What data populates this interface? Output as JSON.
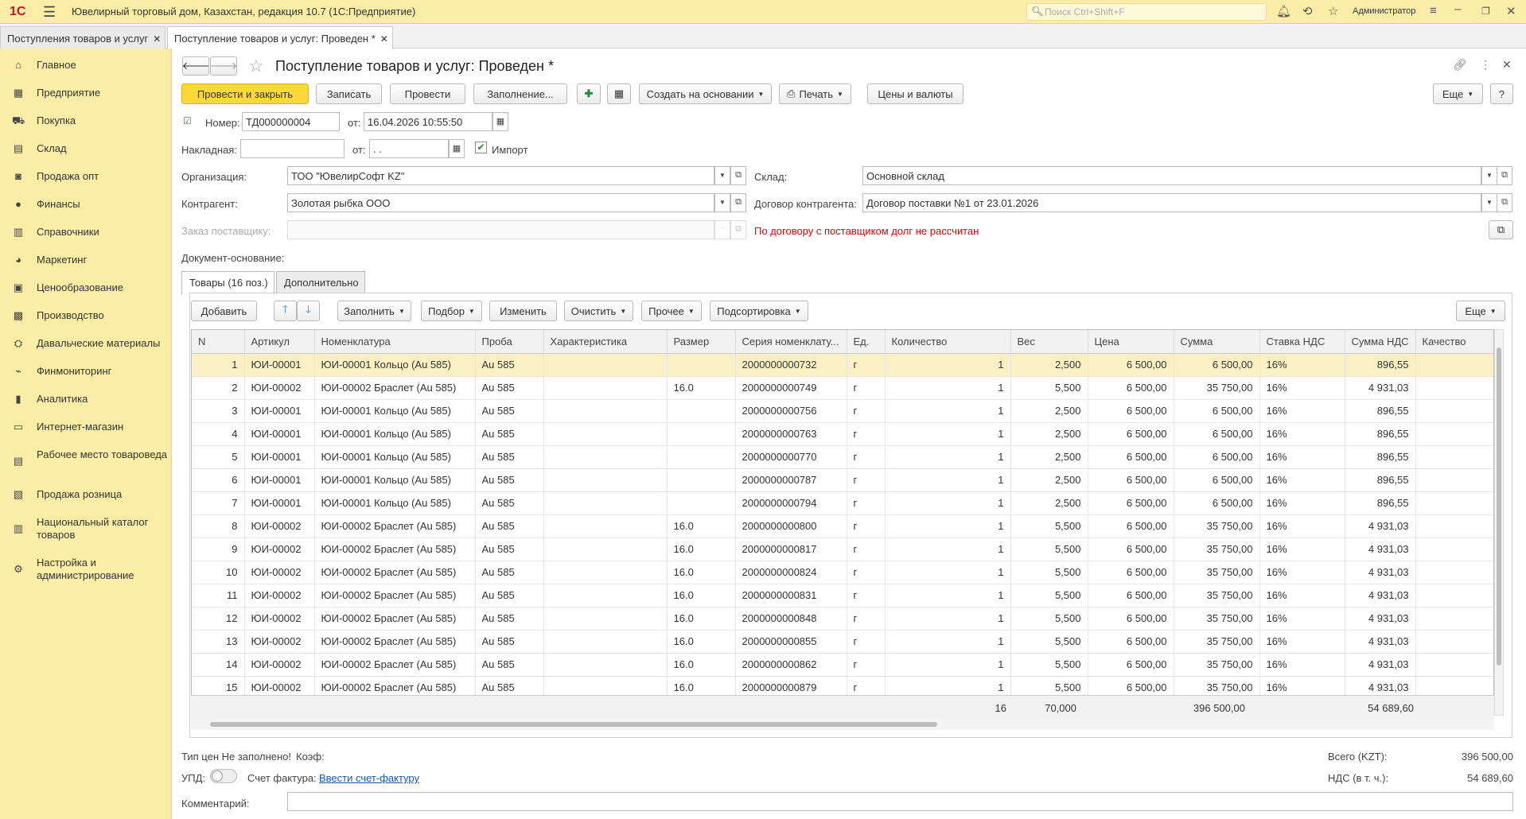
{
  "topbar": {
    "logo": "1С",
    "app_title": "Ювелирный торговый дом, Казахстан, редакция 10.7  (1С:Предприятие)",
    "search_placeholder": "Поиск Ctrl+Shift+F",
    "user": "Администратор"
  },
  "open_tabs": [
    {
      "label": "Поступления товаров и услуг"
    },
    {
      "label": "Поступление товаров и услуг: Проведен *"
    }
  ],
  "sidebar": {
    "items": [
      {
        "label": "Главное",
        "icon": "home-icon"
      },
      {
        "label": "Предприятие",
        "icon": "building-icon"
      },
      {
        "label": "Покупка",
        "icon": "cart-icon"
      },
      {
        "label": "Склад",
        "icon": "warehouse-icon"
      },
      {
        "label": "Продажа опт",
        "icon": "bag-icon"
      },
      {
        "label": "Финансы",
        "icon": "coin-icon"
      },
      {
        "label": "Справочники",
        "icon": "book-icon"
      },
      {
        "label": "Маркетинг",
        "icon": "pie-icon"
      },
      {
        "label": "Ценообразование",
        "icon": "price-icon"
      },
      {
        "label": "Производство",
        "icon": "factory-icon"
      },
      {
        "label": "Давальческие материалы",
        "icon": "materials-icon"
      },
      {
        "label": "Финмониторинг",
        "icon": "monitor-icon"
      },
      {
        "label": "Аналитика",
        "icon": "bars-icon"
      },
      {
        "label": "Интернет-магазин",
        "icon": "shop-icon"
      },
      {
        "label": "Рабочее место товароведа",
        "icon": "workplace-icon"
      },
      {
        "label": "Продажа розница",
        "icon": "retail-icon"
      },
      {
        "label": "Национальный каталог товаров",
        "icon": "catalog-icon"
      },
      {
        "label": "Настройка и администрирование",
        "icon": "gear-icon"
      }
    ]
  },
  "form": {
    "title": "Поступление товаров и услуг: Проведен *",
    "toolbar": {
      "post_close": "Провести и закрыть",
      "save": "Записать",
      "post": "Провести",
      "fill": "Заполнение...",
      "create_based": "Создать на основании",
      "print": "Печать",
      "prices": "Цены и валюты",
      "more": "Еще",
      "help": "?"
    },
    "number_label": "Номер:",
    "number_value": "ТД000000004",
    "date_label": "от:",
    "date_value": "16.04.2026 10:55:50",
    "invoice_label": "Накладная:",
    "invoice_value": "",
    "invoice_date_label": "от:",
    "invoice_date_value": " .  .",
    "import_label": "Импорт",
    "org_label": "Организация:",
    "org_value": "ТОО \"ЮвелирСофт KZ\"",
    "warehouse_label": "Склад:",
    "warehouse_value": "Основной склад",
    "contractor_label": "Контрагент:",
    "contractor_value": "Золотая рыбка ООО",
    "contract_label": "Договор  контрагента:",
    "contract_value": "Договор поставки №1 от 23.01.2026",
    "supplier_order_label": "Заказ поставщику:",
    "supplier_order_value": "",
    "debt_warning": "По договору с поставщиком долг не рассчитан",
    "base_doc_label": "Документ-основание:",
    "tabs": [
      "Товары (16 поз.)",
      "Дополнительно"
    ],
    "table_toolbar": {
      "add": "Добавить",
      "fill": "Заполнить",
      "select": "Подбор",
      "change": "Изменить",
      "clear": "Очистить",
      "other": "Прочее",
      "sort": "Подсортировка",
      "more": "Еще"
    },
    "columns": [
      "N",
      "Артикул",
      "Номенклатура",
      "Проба",
      "Характеристика",
      "Размер",
      "Серия номенклату...",
      "Ед.",
      "Количество",
      "Вес",
      "Цена",
      "Сумма",
      "Ставка НДС",
      "Сумма НДС",
      "Качество"
    ],
    "rows": [
      [
        "1",
        "ЮИ-00001",
        "ЮИ-00001 Кольцо (Au 585)",
        "Au 585",
        "",
        "",
        "2000000000732",
        "г",
        "1",
        "2,500",
        "6 500,00",
        "6 500,00",
        "16%",
        "896,55",
        ""
      ],
      [
        "2",
        "ЮИ-00002",
        "ЮИ-00002 Браслет (Au 585)",
        "Au 585",
        "",
        "16.0",
        "2000000000749",
        "г",
        "1",
        "5,500",
        "6 500,00",
        "35 750,00",
        "16%",
        "4 931,03",
        ""
      ],
      [
        "3",
        "ЮИ-00001",
        "ЮИ-00001 Кольцо (Au 585)",
        "Au 585",
        "",
        "",
        "2000000000756",
        "г",
        "1",
        "2,500",
        "6 500,00",
        "6 500,00",
        "16%",
        "896,55",
        ""
      ],
      [
        "4",
        "ЮИ-00001",
        "ЮИ-00001 Кольцо (Au 585)",
        "Au 585",
        "",
        "",
        "2000000000763",
        "г",
        "1",
        "2,500",
        "6 500,00",
        "6 500,00",
        "16%",
        "896,55",
        ""
      ],
      [
        "5",
        "ЮИ-00001",
        "ЮИ-00001 Кольцо (Au 585)",
        "Au 585",
        "",
        "",
        "2000000000770",
        "г",
        "1",
        "2,500",
        "6 500,00",
        "6 500,00",
        "16%",
        "896,55",
        ""
      ],
      [
        "6",
        "ЮИ-00001",
        "ЮИ-00001 Кольцо (Au 585)",
        "Au 585",
        "",
        "",
        "2000000000787",
        "г",
        "1",
        "2,500",
        "6 500,00",
        "6 500,00",
        "16%",
        "896,55",
        ""
      ],
      [
        "7",
        "ЮИ-00001",
        "ЮИ-00001 Кольцо (Au 585)",
        "Au 585",
        "",
        "",
        "2000000000794",
        "г",
        "1",
        "2,500",
        "6 500,00",
        "6 500,00",
        "16%",
        "896,55",
        ""
      ],
      [
        "8",
        "ЮИ-00002",
        "ЮИ-00002 Браслет (Au 585)",
        "Au 585",
        "",
        "16.0",
        "2000000000800",
        "г",
        "1",
        "5,500",
        "6 500,00",
        "35 750,00",
        "16%",
        "4 931,03",
        ""
      ],
      [
        "9",
        "ЮИ-00002",
        "ЮИ-00002 Браслет (Au 585)",
        "Au 585",
        "",
        "16.0",
        "2000000000817",
        "г",
        "1",
        "5,500",
        "6 500,00",
        "35 750,00",
        "16%",
        "4 931,03",
        ""
      ],
      [
        "10",
        "ЮИ-00002",
        "ЮИ-00002 Браслет (Au 585)",
        "Au 585",
        "",
        "16.0",
        "2000000000824",
        "г",
        "1",
        "5,500",
        "6 500,00",
        "35 750,00",
        "16%",
        "4 931,03",
        ""
      ],
      [
        "11",
        "ЮИ-00002",
        "ЮИ-00002 Браслет (Au 585)",
        "Au 585",
        "",
        "16.0",
        "2000000000831",
        "г",
        "1",
        "5,500",
        "6 500,00",
        "35 750,00",
        "16%",
        "4 931,03",
        ""
      ],
      [
        "12",
        "ЮИ-00002",
        "ЮИ-00002 Браслет (Au 585)",
        "Au 585",
        "",
        "16.0",
        "2000000000848",
        "г",
        "1",
        "5,500",
        "6 500,00",
        "35 750,00",
        "16%",
        "4 931,03",
        ""
      ],
      [
        "13",
        "ЮИ-00002",
        "ЮИ-00002 Браслет (Au 585)",
        "Au 585",
        "",
        "16.0",
        "2000000000855",
        "г",
        "1",
        "5,500",
        "6 500,00",
        "35 750,00",
        "16%",
        "4 931,03",
        ""
      ],
      [
        "14",
        "ЮИ-00002",
        "ЮИ-00002 Браслет (Au 585)",
        "Au 585",
        "",
        "16.0",
        "2000000000862",
        "г",
        "1",
        "5,500",
        "6 500,00",
        "35 750,00",
        "16%",
        "4 931,03",
        ""
      ],
      [
        "15",
        "ЮИ-00002",
        "ЮИ-00002 Браслет (Au 585)",
        "Au 585",
        "",
        "16.0",
        "2000000000879",
        "г",
        "1",
        "5,500",
        "6 500,00",
        "35 750,00",
        "16%",
        "4 931,03",
        ""
      ]
    ],
    "totals": {
      "qty": "16",
      "weight": "70,000",
      "sum": "396 500,00",
      "vat": "54 689,60"
    },
    "price_type_label": "Тип цен Не заполнено!",
    "coef_label": "Коэф:",
    "total_label": "Всего (KZT):",
    "total_value": "396 500,00",
    "vat_label": "НДС (в т. ч.):",
    "vat_value": "54 689,60",
    "upd_label": "УПД:",
    "invoice_fact_label": "Счет фактура:",
    "invoice_fact_link": "Ввести счет-фактуру",
    "comment_label": "Комментарий:",
    "comment_value": ""
  }
}
